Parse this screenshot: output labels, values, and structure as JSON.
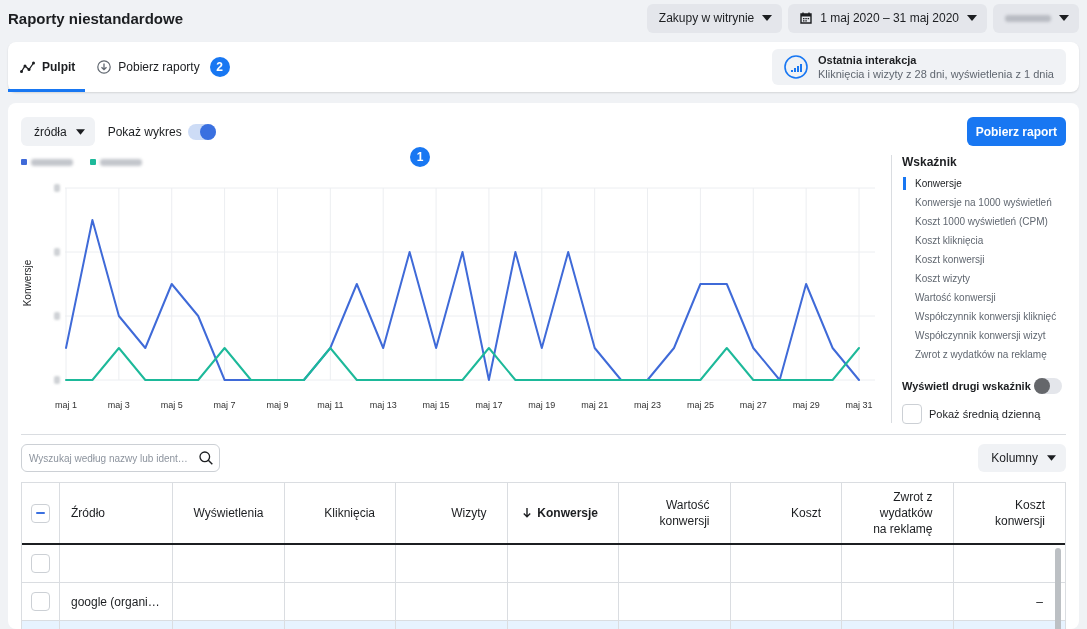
{
  "header": {
    "title": "Raporty niestandardowe",
    "buttons": [
      {
        "kind": "dropdown",
        "label": "Zakupy w witrynie"
      },
      {
        "kind": "date",
        "label": "1 maj 2020 – 31 maj 2020"
      },
      {
        "kind": "redacted"
      }
    ]
  },
  "tabs": [
    {
      "kind": "dashboard",
      "label": "Pulpit",
      "selected": true
    },
    {
      "kind": "downloads",
      "label": "Pobierz raporty",
      "selected": false,
      "badge": "2"
    }
  ],
  "attribution": {
    "title": "Ostatnia interakcja",
    "text": "Kliknięcia i wizyty z 28 dni, wyświetlenia z 1 dnia"
  },
  "toolbar": {
    "breakdown": "źródła",
    "chart_toggle": {
      "label": "Pokaż wykres",
      "on": true
    },
    "download_button": "Pobierz raport"
  },
  "chart": {
    "badge": "1",
    "ylabel": "Konwersje",
    "x_labels": [
      "maj 1",
      "maj 3",
      "maj 5",
      "maj 7",
      "maj 9",
      "maj 11",
      "maj 13",
      "maj 15",
      "maj 17",
      "maj 19",
      "maj 21",
      "maj 23",
      "maj 25",
      "maj 27",
      "maj 29",
      "maj 31"
    ],
    "series": [
      {
        "color": "#3f6ad8"
      },
      {
        "color": "#1db99a"
      }
    ]
  },
  "metrics": {
    "title": "Wskaźnik",
    "items": [
      {
        "label": "Konwersje",
        "selected": true
      },
      {
        "label": "Konwersje na 1000 wyświetleń",
        "selected": false
      },
      {
        "label": "Koszt 1000 wyświetleń (CPM)",
        "selected": false
      },
      {
        "label": "Koszt kliknięcia",
        "selected": false
      },
      {
        "label": "Koszt konwersji",
        "selected": false
      },
      {
        "label": "Koszt wizyty",
        "selected": false
      },
      {
        "label": "Wartość konwersji",
        "selected": false
      },
      {
        "label": "Współczynnik konwersji kliknięć",
        "selected": false
      },
      {
        "label": "Współczynnik konwersji wizyt",
        "selected": false
      },
      {
        "label": "Zwrot z wydatków na reklamę",
        "selected": false
      }
    ],
    "second_metric": {
      "label": "Wyświetl drugi wskaźnik",
      "on": false
    },
    "daily_average": {
      "label": "Pokaż średnią dzienną",
      "checked": false
    }
  },
  "table": {
    "search": {
      "placeholder": "Wyszukaj według nazwy lub ident…"
    },
    "columns_button": "Kolumny",
    "header_checkbox": {
      "indeterminate": true
    },
    "columns": [
      {
        "label": "Źródło",
        "sorted": false
      },
      {
        "label": "Wyświetlenia",
        "sorted": false
      },
      {
        "label": "Kliknięcia",
        "sorted": false
      },
      {
        "label": "Wizyty",
        "sorted": false
      },
      {
        "label": "Konwersje",
        "sorted": true
      },
      {
        "label": "Wartość konwersji",
        "sorted": false
      },
      {
        "label": "Koszt",
        "sorted": false
      },
      {
        "label": "Zwrot z wydatków na reklamę",
        "sorted": false
      },
      {
        "label": "Koszt konwersji",
        "sorted": false
      }
    ],
    "rows": [
      {
        "checked": false,
        "selected": false
      },
      {
        "checked": false,
        "selected": false,
        "source": "google (organi…",
        "cost_per_conversion": "–"
      },
      {
        "selected": true
      }
    ]
  }
}
